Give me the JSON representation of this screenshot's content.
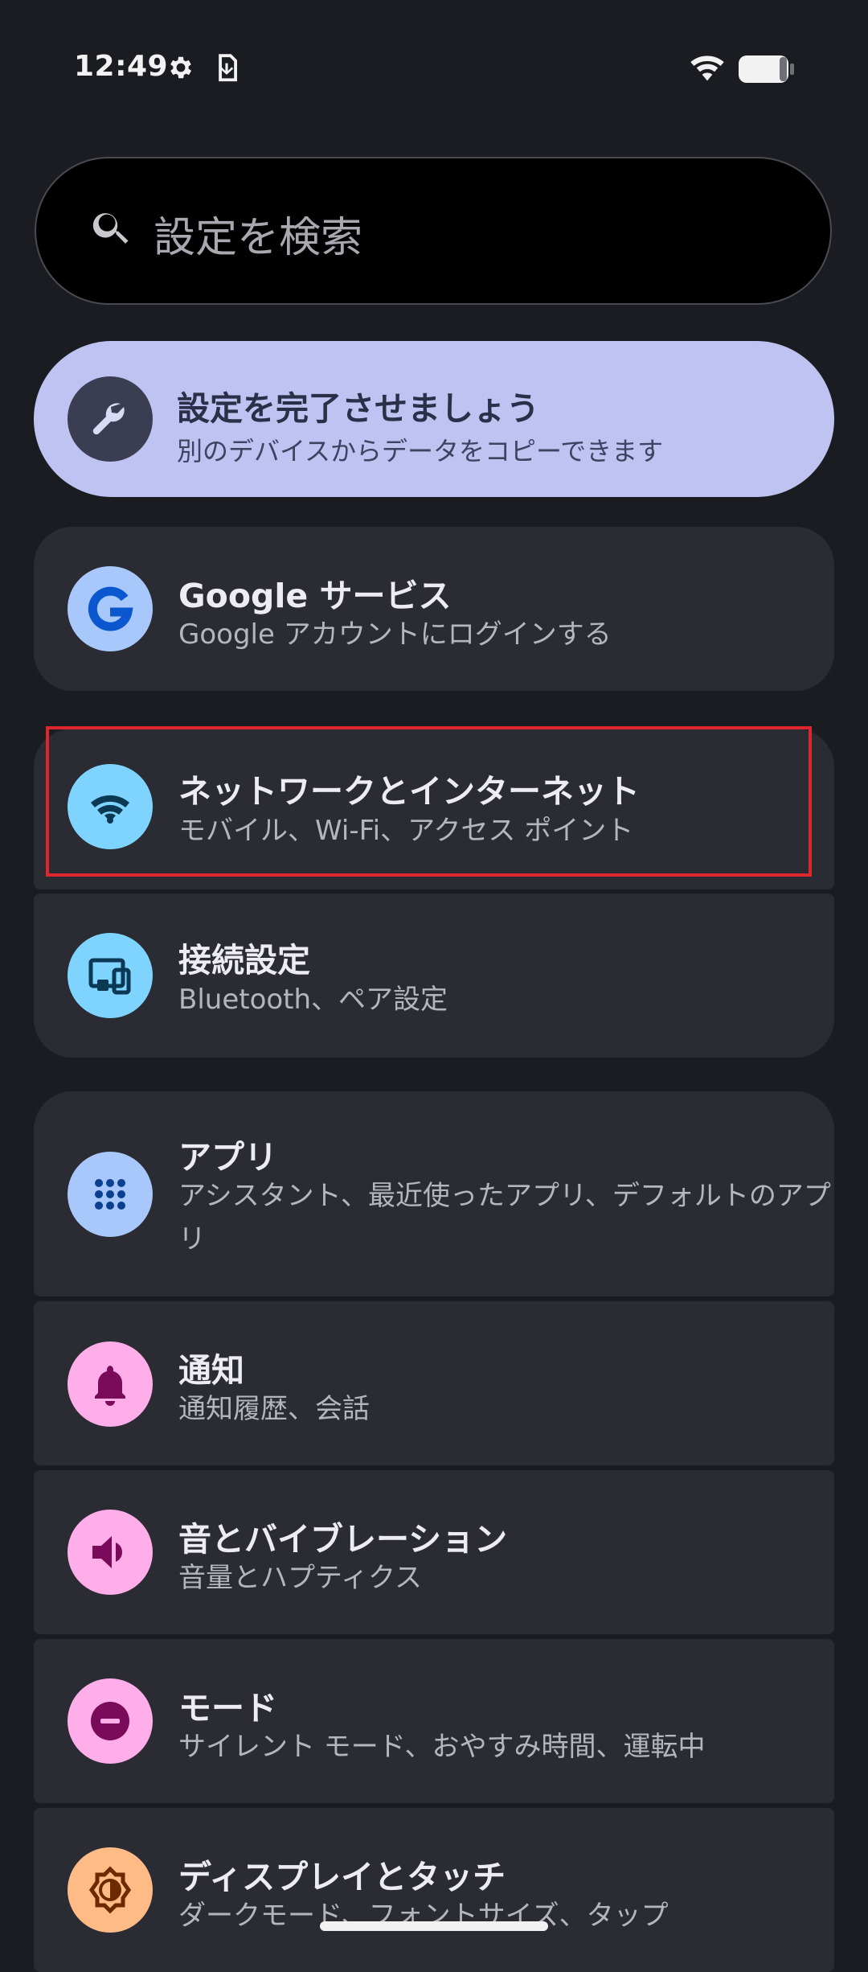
{
  "status": {
    "time": "12:49"
  },
  "search": {
    "placeholder": "設定を検索"
  },
  "promo": {
    "title": "設定を完了させましょう",
    "subtitle": "別のデバイスからデータをコピーできます",
    "icon": "wrench-icon"
  },
  "items": [
    {
      "title": "Google サービス",
      "subtitle": "Google アカウントにログインする",
      "icon": "google-g-icon",
      "icon_bg": "#a8c7fa"
    },
    {
      "title": "ネットワークとインターネット",
      "subtitle": "モバイル、Wi-Fi、アクセス ポイント",
      "icon": "wifi-icon",
      "icon_bg": "#7fd4ff"
    },
    {
      "title": "接続設定",
      "subtitle": "Bluetooth、ペア設定",
      "icon": "connected-devices-icon",
      "icon_bg": "#7fd4ff"
    },
    {
      "title": "アプリ",
      "subtitle": "アシスタント、最近使ったアプリ、デフォルトのアプリ",
      "icon": "apps-grid-icon",
      "icon_bg": "#a8c7fa"
    },
    {
      "title": "通知",
      "subtitle": "通知履歴、会話",
      "icon": "bell-icon",
      "icon_bg": "#ffaee9"
    },
    {
      "title": "音とバイブレーション",
      "subtitle": "音量とハプティクス",
      "icon": "volume-icon",
      "icon_bg": "#ffaee9"
    },
    {
      "title": "モード",
      "subtitle": "サイレント モード、おやすみ時間、運転中",
      "icon": "do-not-disturb-icon",
      "icon_bg": "#ffaee9"
    },
    {
      "title": "ディスプレイとタッチ",
      "subtitle": "ダークモード、フォントサイズ、タップ",
      "icon": "brightness-icon",
      "icon_bg": "#ffbb86"
    }
  ]
}
